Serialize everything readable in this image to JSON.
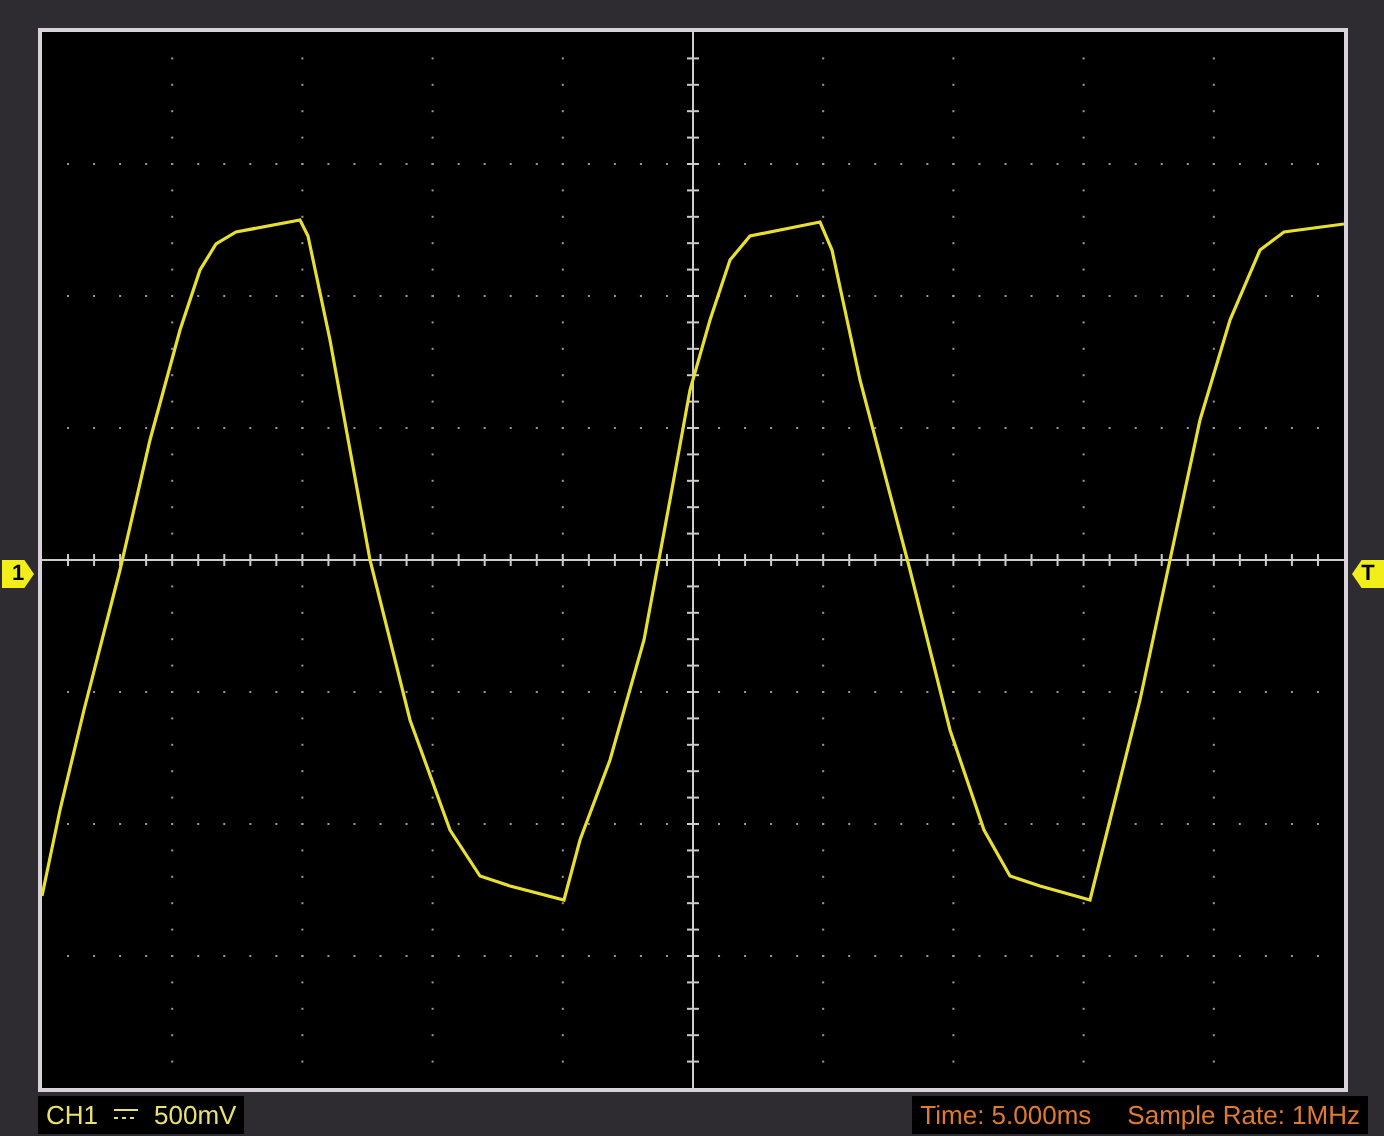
{
  "channel_marker": "1",
  "trigger_marker": "T",
  "status_bar": {
    "channel": "CH1",
    "volts_per_div": "500mV",
    "time_base": "Time: 5.000ms",
    "sample_rate": "Sample Rate: 1MHz"
  }
}
